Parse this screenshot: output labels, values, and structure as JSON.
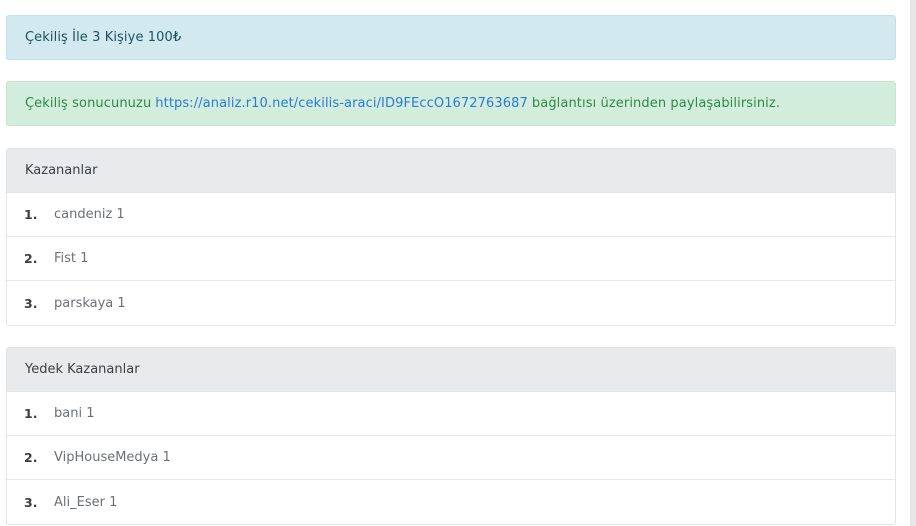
{
  "info_alert": {
    "text": "Çekiliş İle 3 Kişiye 100₺"
  },
  "success_alert": {
    "prefix": "Çekiliş sonucunuzu",
    "link": "https://analiz.r10.net/cekilis-araci/ID9FEccO1672763687",
    "suffix": "bağlantısı üzerinden paylaşabilirsiniz."
  },
  "winners": {
    "title": "Kazananlar",
    "items": [
      {
        "num": "1.",
        "name": "candeniz 1"
      },
      {
        "num": "2.",
        "name": "Fist 1"
      },
      {
        "num": "3.",
        "name": "parskaya 1"
      }
    ]
  },
  "backup_winners": {
    "title": "Yedek Kazananlar",
    "items": [
      {
        "num": "1.",
        "name": "bani 1"
      },
      {
        "num": "2.",
        "name": "VipHouseMedya 1"
      },
      {
        "num": "3.",
        "name": "Ali_Eser 1"
      }
    ]
  }
}
